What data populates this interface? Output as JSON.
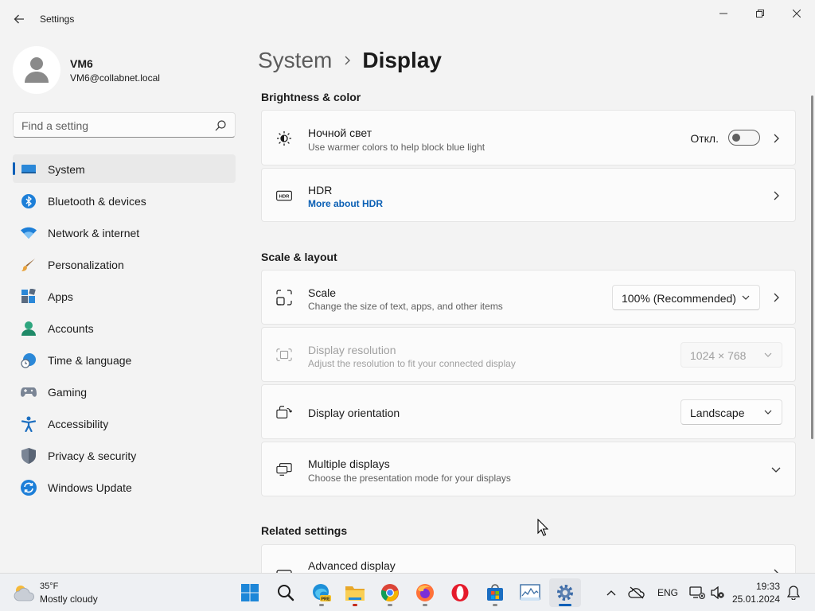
{
  "window": {
    "title": "Settings"
  },
  "profile": {
    "name": "VM6",
    "email": "VM6@collabnet.local"
  },
  "search": {
    "placeholder": "Find a setting"
  },
  "sidebar": {
    "items": [
      {
        "label": "System",
        "icon": "monitor-icon",
        "selected": true
      },
      {
        "label": "Bluetooth & devices",
        "icon": "bluetooth-icon"
      },
      {
        "label": "Network & internet",
        "icon": "wifi-icon"
      },
      {
        "label": "Personalization",
        "icon": "brush-icon"
      },
      {
        "label": "Apps",
        "icon": "apps-icon"
      },
      {
        "label": "Accounts",
        "icon": "person-icon"
      },
      {
        "label": "Time & language",
        "icon": "globe-clock-icon"
      },
      {
        "label": "Gaming",
        "icon": "gamepad-icon"
      },
      {
        "label": "Accessibility",
        "icon": "accessibility-icon"
      },
      {
        "label": "Privacy & security",
        "icon": "shield-icon"
      },
      {
        "label": "Windows Update",
        "icon": "update-icon"
      }
    ]
  },
  "breadcrumb": {
    "parent": "System",
    "current": "Display"
  },
  "sections": {
    "brightness": "Brightness & color",
    "scale": "Scale & layout",
    "related": "Related settings"
  },
  "settings": {
    "night_light": {
      "title": "Ночной свет",
      "subtitle": "Use warmer colors to help block blue light",
      "state_label": "Откл.",
      "enabled": false
    },
    "hdr": {
      "title": "HDR",
      "link": "More about HDR"
    },
    "scale": {
      "title": "Scale",
      "subtitle": "Change the size of text, apps, and other items",
      "value": "100% (Recommended)"
    },
    "resolution": {
      "title": "Display resolution",
      "subtitle": "Adjust the resolution to fit your connected display",
      "value": "1024 × 768"
    },
    "orientation": {
      "title": "Display orientation",
      "value": "Landscape"
    },
    "multiple": {
      "title": "Multiple displays",
      "subtitle": "Choose the presentation mode for your displays"
    },
    "advanced": {
      "title": "Advanced display"
    }
  },
  "taskbar": {
    "weather_temp": "35°F",
    "weather_desc": "Mostly cloudy",
    "language": "ENG",
    "time": "19:33",
    "date": "25.01.2024"
  },
  "colors": {
    "accent": "#005fb8",
    "link": "#0a5fb4"
  }
}
